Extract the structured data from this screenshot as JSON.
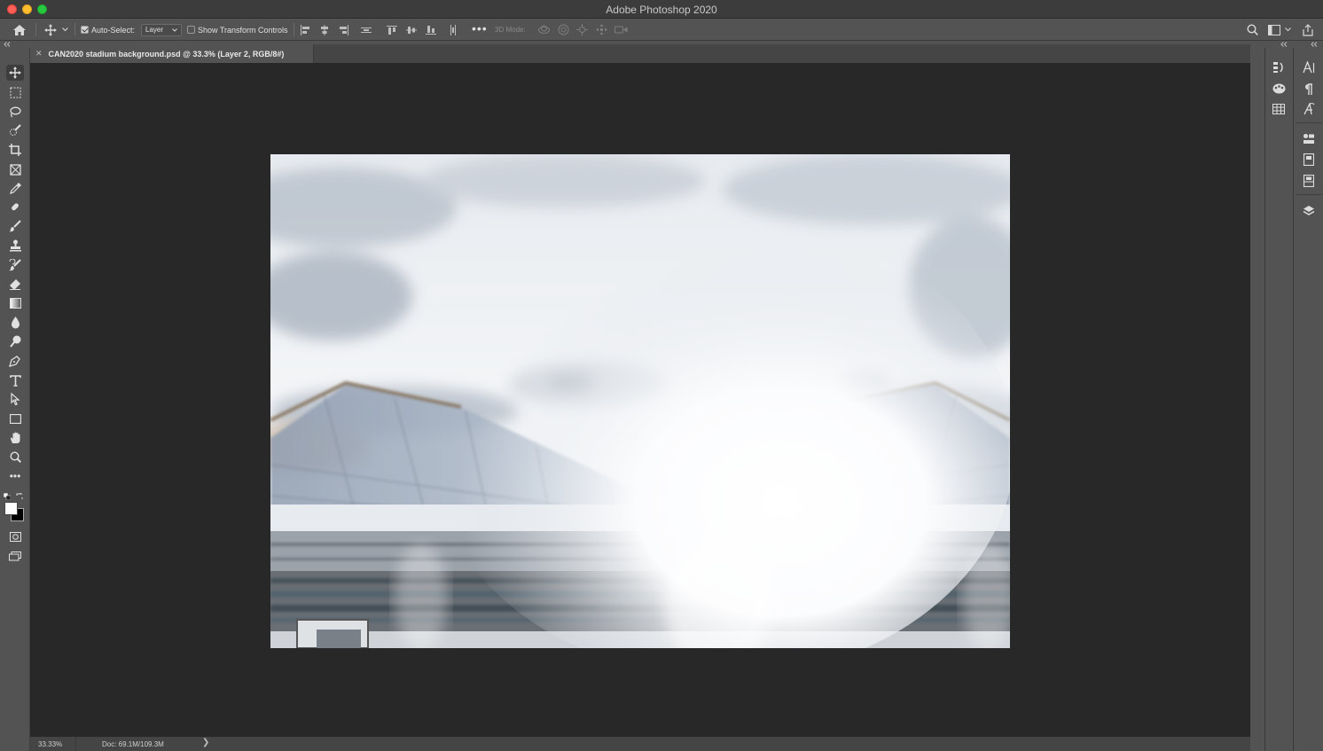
{
  "window": {
    "title": "Adobe Photoshop 2020"
  },
  "options_bar": {
    "auto_select_label": "Auto-Select:",
    "auto_select_checked": true,
    "auto_select_target": "Layer",
    "show_transform_label": "Show Transform Controls",
    "show_transform_checked": false,
    "mode_3d_label": "3D Mode:"
  },
  "document_tab": {
    "label": "CAN2020 stadium background.psd @ 33.3% (Layer 2, RGB/8#)"
  },
  "status_bar": {
    "zoom": "33.33%",
    "doc_info": "Doc: 69.1M/109.3M",
    "more_arrow": "❯"
  },
  "toolbar": {
    "active_tool": "move-tool",
    "foreground_color": "#ffffff",
    "background_color": "#000000"
  },
  "canvas": {
    "background": "#282828"
  }
}
